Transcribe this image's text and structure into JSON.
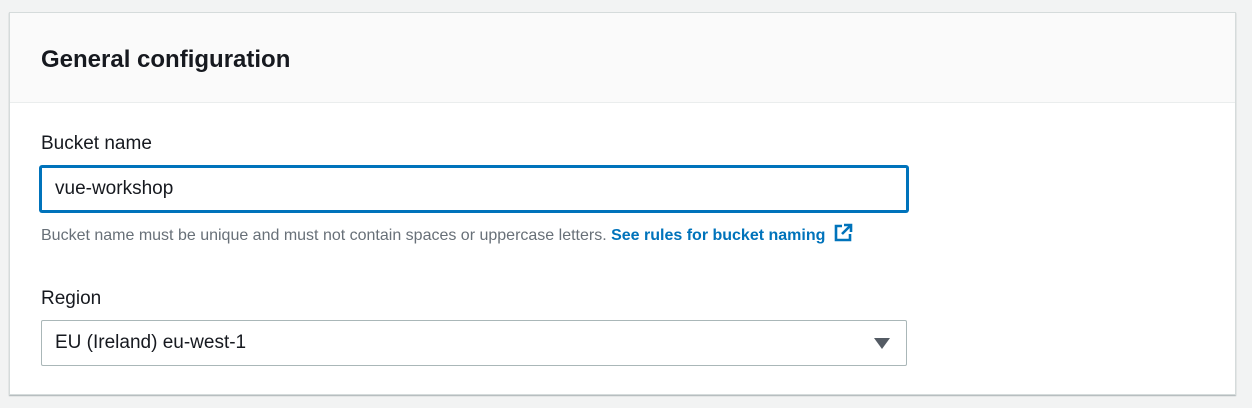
{
  "panel": {
    "title": "General configuration"
  },
  "bucket_name": {
    "label": "Bucket name",
    "value": "vue-workshop",
    "hint_text": "Bucket name must be unique and must not contain spaces or uppercase letters.",
    "hint_link": "See rules for bucket naming",
    "link_icon": "external-link-icon"
  },
  "region": {
    "label": "Region",
    "selected": "EU (Ireland) eu-west-1",
    "icon": "caret-down-icon"
  },
  "colors": {
    "accent": "#0073bb",
    "text": "#16191f",
    "hint": "#687078",
    "border": "#aab7b8"
  }
}
